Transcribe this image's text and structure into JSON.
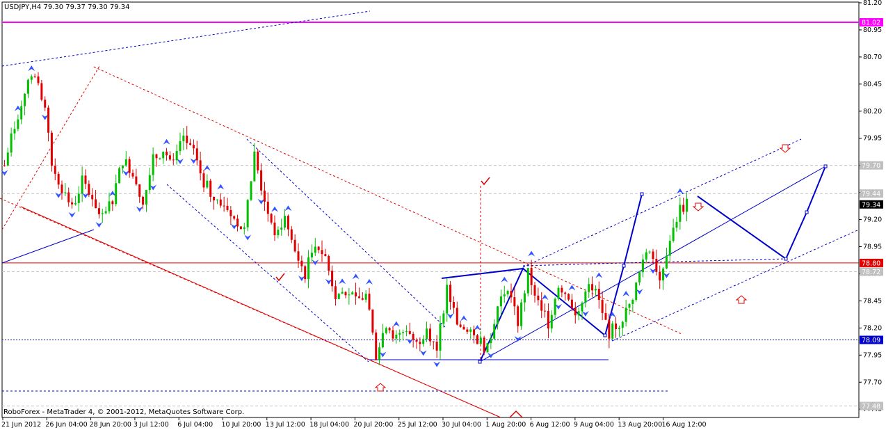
{
  "header": {
    "symbol_line": "USDJPY,H4  79.30 79.37 79.30 79.34"
  },
  "footer": {
    "copyright": "RoboForex - MetaTrader 4, © 2001-2012, MetaQuotes Software Corp."
  },
  "colors": {
    "background": "#ffffff",
    "bull_candle": "#00c000",
    "bear_candle": "#e00000",
    "resistance_line": "#ff00ff",
    "support_line": "#e00000",
    "trend_blue": "#0000cc",
    "trend_red": "#e00000",
    "fractal_marker": "#3355ff",
    "label_box": "#c0c0c0",
    "current_box": "#000000"
  },
  "chart_data": {
    "type": "candlestick",
    "symbol": "USDJPY",
    "timeframe": "H4",
    "last_ohlc": {
      "open": 79.3,
      "high": 79.37,
      "low": 79.3,
      "close": 79.34
    },
    "ylim": [
      77.4,
      81.2
    ],
    "y_ticks": [
      81.2,
      80.95,
      80.7,
      80.45,
      80.2,
      79.95,
      79.7,
      79.45,
      79.2,
      78.95,
      78.7,
      78.45,
      78.2,
      77.95,
      77.7,
      77.45
    ],
    "x_labels": [
      "21 Jun 2012",
      "26 Jun 04:00",
      "28 Jun 20:00",
      "3 Jul 12:00",
      "6 Jul 04:00",
      "10 Jul 20:00",
      "13 Jul 12:00",
      "18 Jul 04:00",
      "20 Jul 20:00",
      "25 Jul 12:00",
      "30 Jul 04:00",
      "1 Aug 20:00",
      "6 Aug 12:00",
      "9 Aug 04:00",
      "13 Aug 20:00",
      "16 Aug 12:00"
    ],
    "price_labels": [
      {
        "value": 81.02,
        "text": "81.02",
        "style": "magenta"
      },
      {
        "value": 79.7,
        "text": "79.70",
        "style": "gray"
      },
      {
        "value": 79.44,
        "text": "79.44",
        "style": "gray"
      },
      {
        "value": 79.34,
        "text": "79.34",
        "style": "current"
      },
      {
        "value": 78.8,
        "text": "78.80",
        "style": "red"
      },
      {
        "value": 78.72,
        "text": "78.72",
        "style": "gray"
      },
      {
        "value": 78.09,
        "text": "78.09",
        "style": "blue"
      },
      {
        "value": 77.48,
        "text": "77.48",
        "style": "gray"
      }
    ],
    "horizontal_lines": [
      {
        "value": 81.02,
        "style": "magenta"
      },
      {
        "value": 79.7,
        "style": "gray-dash"
      },
      {
        "value": 79.44,
        "style": "gray-dash"
      },
      {
        "value": 78.8,
        "style": "red"
      },
      {
        "value": 78.72,
        "style": "gray-dash"
      },
      {
        "value": 78.09,
        "style": "blue-dot"
      },
      {
        "value": 77.48,
        "style": "gray-dash"
      }
    ],
    "price_path": [
      [
        0,
        79.7
      ],
      [
        2,
        79.95
      ],
      [
        6,
        80.4
      ],
      [
        9,
        80.5
      ],
      [
        12,
        80.2
      ],
      [
        14,
        79.7
      ],
      [
        17,
        79.5
      ],
      [
        20,
        79.3
      ],
      [
        23,
        79.55
      ],
      [
        26,
        79.4
      ],
      [
        29,
        79.2
      ],
      [
        32,
        79.4
      ],
      [
        35,
        79.75
      ],
      [
        38,
        79.65
      ],
      [
        41,
        79.35
      ],
      [
        44,
        79.75
      ],
      [
        47,
        79.85
      ],
      [
        50,
        79.7
      ],
      [
        53,
        79.95
      ],
      [
        56,
        79.8
      ],
      [
        59,
        79.55
      ],
      [
        62,
        79.4
      ],
      [
        65,
        79.35
      ],
      [
        68,
        79.2
      ],
      [
        71,
        79.1
      ],
      [
        74,
        79.8
      ],
      [
        77,
        79.35
      ],
      [
        80,
        79.1
      ],
      [
        83,
        79.2
      ],
      [
        86,
        78.9
      ],
      [
        89,
        78.7
      ],
      [
        92,
        79.0
      ],
      [
        95,
        78.85
      ],
      [
        98,
        78.5
      ],
      [
        101,
        78.55
      ],
      [
        104,
        78.45
      ],
      [
        107,
        78.5
      ],
      [
        110,
        77.95
      ],
      [
        113,
        78.25
      ],
      [
        116,
        78.1
      ],
      [
        119,
        78.2
      ],
      [
        122,
        78.05
      ],
      [
        125,
        78.2
      ],
      [
        128,
        78.0
      ],
      [
        131,
        78.55
      ],
      [
        134,
        78.25
      ],
      [
        137,
        78.15
      ],
      [
        140,
        78.1
      ],
      [
        143,
        78.0
      ],
      [
        146,
        78.4
      ],
      [
        149,
        78.6
      ],
      [
        152,
        78.25
      ],
      [
        155,
        78.7
      ],
      [
        158,
        78.45
      ],
      [
        161,
        78.25
      ],
      [
        164,
        78.6
      ],
      [
        167,
        78.5
      ],
      [
        170,
        78.3
      ],
      [
        173,
        78.65
      ],
      [
        176,
        78.45
      ],
      [
        179,
        78.15
      ],
      [
        182,
        78.25
      ],
      [
        185,
        78.4
      ],
      [
        188,
        78.7
      ],
      [
        191,
        78.95
      ],
      [
        194,
        78.65
      ],
      [
        197,
        79.05
      ],
      [
        200,
        79.3
      ],
      [
        202,
        79.34
      ]
    ]
  }
}
